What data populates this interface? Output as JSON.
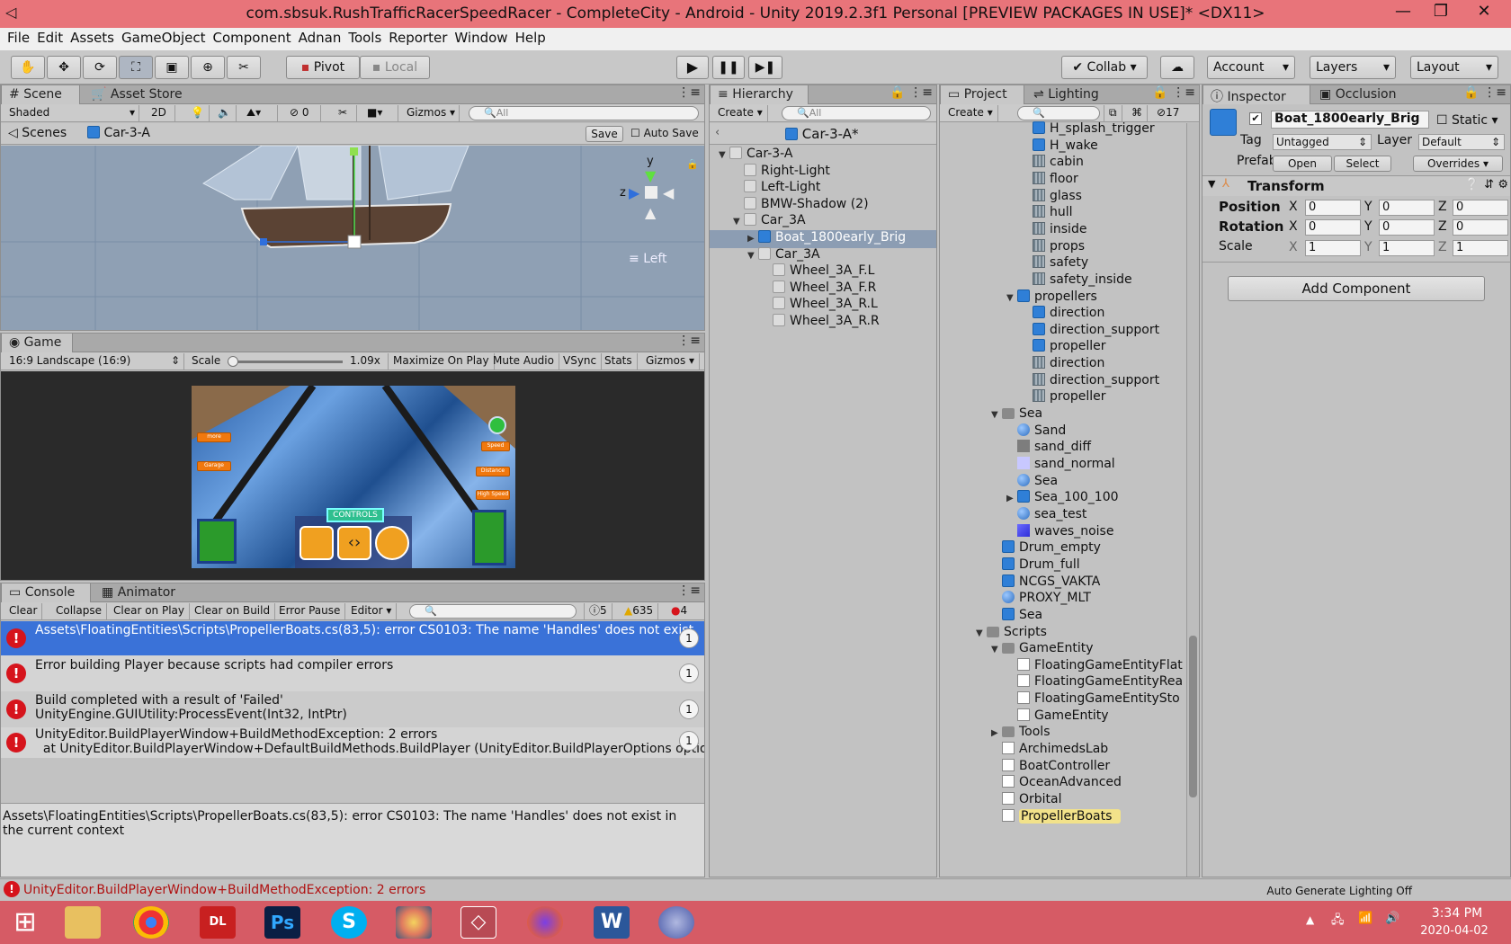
{
  "window": {
    "title": "com.sbsuk.RushTrafficRacerSpeedRacer - CompleteCity - Android - Unity 2019.2.3f1 Personal [PREVIEW PACKAGES IN USE]* <DX11>",
    "minimize": "—",
    "maximize": "❐",
    "close": "✕"
  },
  "menu": [
    "File",
    "Edit",
    "Assets",
    "GameObject",
    "Component",
    "Adnan",
    "Tools",
    "Reporter",
    "Window",
    "Help"
  ],
  "toolbar": {
    "pivot": "Pivot",
    "local": "Local",
    "collab": "Collab",
    "account": "Account",
    "layers": "Layers",
    "layout": "Layout"
  },
  "scene": {
    "tab_scene": "Scene",
    "tab_asset_store": "Asset Store",
    "shading": "Shaded",
    "mode_2d": "2D",
    "hidden_count": "0",
    "gizmos": "Gizmos",
    "search_placeholder": "All",
    "breadcrumb_root": "Scenes",
    "breadcrumb_item": "Car-3-A",
    "save": "Save",
    "auto_save": "Auto Save",
    "view_label": "Left",
    "axis_y": "y",
    "axis_z": "z"
  },
  "game": {
    "tab": "Game",
    "aspect": "16:9 Landscape (16:9)",
    "scale_label": "Scale",
    "scale_value": "1.09x",
    "maximize_on_play": "Maximize On Play",
    "mute_audio": "Mute Audio",
    "vsync": "VSync",
    "stats": "Stats",
    "gizmos": "Gizmos",
    "hud": {
      "controls": "CONTROLS",
      "more": "more",
      "garage": "Garage",
      "speed": "Speed",
      "distance": "Distance",
      "high_speed": "High Speed"
    }
  },
  "console": {
    "tab": "Console",
    "tab_animator": "Animator",
    "clear": "Clear",
    "collapse": "Collapse",
    "clear_on_play": "Clear on Play",
    "clear_on_build": "Clear on Build",
    "error_pause": "Error Pause",
    "editor": "Editor",
    "log_count": "5",
    "warn_count": "635",
    "error_count": "4",
    "messages": [
      {
        "line1": "Assets\\FloatingEntities\\Scripts\\PropellerBoats.cs(83,5): error CS0103: The name 'Handles' does not exist",
        "line2": "",
        "count": "1",
        "selected": true
      },
      {
        "line1": "Error building Player because scripts had compiler errors",
        "line2": "",
        "count": "1",
        "selected": false
      },
      {
        "line1": "Build completed with a result of 'Failed'",
        "line2": "UnityEngine.GUIUtility:ProcessEvent(Int32, IntPtr)",
        "count": "1",
        "selected": false
      },
      {
        "line1": "UnityEditor.BuildPlayerWindow+BuildMethodException: 2 errors",
        "line2": "  at UnityEditor.BuildPlayerWindow+DefaultBuildMethods.BuildPlayer (UnityEditor.BuildPlayerOptions options)",
        "count": "1",
        "selected": false
      }
    ],
    "detail_line1": "Assets\\FloatingEntities\\Scripts\\PropellerBoats.cs(83,5): error CS0103: The name 'Handles' does not exist in",
    "detail_line2": "the current context"
  },
  "hierarchy": {
    "tab": "Hierarchy",
    "create": "Create",
    "search_placeholder": "All",
    "scene_name": "Car-3-A*",
    "items": [
      {
        "label": "Car-3-A",
        "indent": 0,
        "arrow": "▼",
        "icon": "cubeg",
        "selected": false
      },
      {
        "label": "Right-Light",
        "indent": 1,
        "arrow": "",
        "icon": "cubeg",
        "selected": false
      },
      {
        "label": "Left-Light",
        "indent": 1,
        "arrow": "",
        "icon": "cubeg",
        "selected": false
      },
      {
        "label": "BMW-Shadow (2)",
        "indent": 1,
        "arrow": "",
        "icon": "cubeg",
        "selected": false
      },
      {
        "label": "Car_3A",
        "indent": 1,
        "arrow": "▼",
        "icon": "cubeg",
        "selected": false
      },
      {
        "label": "Boat_1800early_Brig",
        "indent": 2,
        "arrow": "▶",
        "icon": "cube",
        "selected": true
      },
      {
        "label": "Car_3A",
        "indent": 2,
        "arrow": "▼",
        "icon": "cubeg",
        "selected": false
      },
      {
        "label": "Wheel_3A_F.L",
        "indent": 3,
        "arrow": "",
        "icon": "cubeg",
        "selected": false
      },
      {
        "label": "Wheel_3A_F.R",
        "indent": 3,
        "arrow": "",
        "icon": "cubeg",
        "selected": false
      },
      {
        "label": "Wheel_3A_R.L",
        "indent": 3,
        "arrow": "",
        "icon": "cubeg",
        "selected": false
      },
      {
        "label": "Wheel_3A_R.R",
        "indent": 3,
        "arrow": "",
        "icon": "cubeg",
        "selected": false
      }
    ]
  },
  "project": {
    "tab": "Project",
    "tab_lighting": "Lighting",
    "create": "Create",
    "hidden_count": "17",
    "items": [
      {
        "label": "H_splash_trigger",
        "indent": 3,
        "arrow": "",
        "icon": "cube"
      },
      {
        "label": "H_wake",
        "indent": 3,
        "arrow": "",
        "icon": "cube"
      },
      {
        "label": "cabin",
        "indent": 3,
        "arrow": "",
        "icon": "mesh"
      },
      {
        "label": "floor",
        "indent": 3,
        "arrow": "",
        "icon": "mesh"
      },
      {
        "label": "glass",
        "indent": 3,
        "arrow": "",
        "icon": "mesh"
      },
      {
        "label": "hull",
        "indent": 3,
        "arrow": "",
        "icon": "mesh"
      },
      {
        "label": "inside",
        "indent": 3,
        "arrow": "",
        "icon": "mesh"
      },
      {
        "label": "props",
        "indent": 3,
        "arrow": "",
        "icon": "mesh"
      },
      {
        "label": "safety",
        "indent": 3,
        "arrow": "",
        "icon": "mesh"
      },
      {
        "label": "safety_inside",
        "indent": 3,
        "arrow": "",
        "icon": "mesh"
      },
      {
        "label": "propellers",
        "indent": 2,
        "arrow": "▼",
        "icon": "cube"
      },
      {
        "label": "direction",
        "indent": 3,
        "arrow": "",
        "icon": "cube"
      },
      {
        "label": "direction_support",
        "indent": 3,
        "arrow": "",
        "icon": "cube"
      },
      {
        "label": "propeller",
        "indent": 3,
        "arrow": "",
        "icon": "cube"
      },
      {
        "label": "direction",
        "indent": 3,
        "arrow": "",
        "icon": "mesh"
      },
      {
        "label": "direction_support",
        "indent": 3,
        "arrow": "",
        "icon": "mesh"
      },
      {
        "label": "propeller",
        "indent": 3,
        "arrow": "",
        "icon": "mesh"
      },
      {
        "label": "Sea",
        "indent": 1,
        "arrow": "▼",
        "icon": "folder"
      },
      {
        "label": "Sand",
        "indent": 2,
        "arrow": "",
        "icon": "sphere"
      },
      {
        "label": "sand_diff",
        "indent": 2,
        "arrow": "",
        "icon": "tex_gray"
      },
      {
        "label": "sand_normal",
        "indent": 2,
        "arrow": "",
        "icon": "tex_lav"
      },
      {
        "label": "Sea",
        "indent": 2,
        "arrow": "",
        "icon": "sphere"
      },
      {
        "label": "Sea_100_100",
        "indent": 2,
        "arrow": "▶",
        "icon": "cube"
      },
      {
        "label": "sea_test",
        "indent": 2,
        "arrow": "",
        "icon": "sphere"
      },
      {
        "label": "waves_noise",
        "indent": 2,
        "arrow": "",
        "icon": "tex_blue"
      },
      {
        "label": "Drum_empty",
        "indent": 1,
        "arrow": "",
        "icon": "cube"
      },
      {
        "label": "Drum_full",
        "indent": 1,
        "arrow": "",
        "icon": "cube"
      },
      {
        "label": "NCGS_VAKTA",
        "indent": 1,
        "arrow": "",
        "icon": "cube"
      },
      {
        "label": "PROXY_MLT",
        "indent": 1,
        "arrow": "",
        "icon": "sphere"
      },
      {
        "label": "Sea",
        "indent": 1,
        "arrow": "",
        "icon": "cube"
      },
      {
        "label": "Scripts",
        "indent": 0,
        "arrow": "▼",
        "icon": "folder"
      },
      {
        "label": "GameEntity",
        "indent": 1,
        "arrow": "▼",
        "icon": "folder"
      },
      {
        "label": "FloatingGameEntityFlat",
        "indent": 2,
        "arrow": "",
        "icon": "script"
      },
      {
        "label": "FloatingGameEntityRea",
        "indent": 2,
        "arrow": "",
        "icon": "script"
      },
      {
        "label": "FloatingGameEntitySto",
        "indent": 2,
        "arrow": "",
        "icon": "script"
      },
      {
        "label": "GameEntity",
        "indent": 2,
        "arrow": "",
        "icon": "script"
      },
      {
        "label": "Tools",
        "indent": 1,
        "arrow": "▶",
        "icon": "folder"
      },
      {
        "label": "ArchimedsLab",
        "indent": 1,
        "arrow": "",
        "icon": "script"
      },
      {
        "label": "BoatController",
        "indent": 1,
        "arrow": "",
        "icon": "script"
      },
      {
        "label": "OceanAdvanced",
        "indent": 1,
        "arrow": "",
        "icon": "script"
      },
      {
        "label": "Orbital",
        "indent": 1,
        "arrow": "",
        "icon": "script"
      },
      {
        "label": "PropellerBoats",
        "indent": 1,
        "arrow": "",
        "icon": "script",
        "highlight": true
      }
    ]
  },
  "inspector": {
    "tab": "Inspector",
    "tab_occlusion": "Occlusion",
    "object_name": "Boat_1800early_Brig",
    "static": "Static",
    "tag_label": "Tag",
    "tag_value": "Untagged",
    "layer_label": "Layer",
    "layer_value": "Default",
    "prefab_label": "Prefab",
    "open": "Open",
    "select": "Select",
    "overrides": "Overrides",
    "transform": "Transform",
    "position_label": "Position",
    "rotation_label": "Rotation",
    "scale_label": "Scale",
    "position": {
      "x": "0",
      "y": "0",
      "z": "0"
    },
    "rotation": {
      "x": "0",
      "y": "0",
      "z": "0"
    },
    "scale": {
      "x": "1",
      "y": "1",
      "z": "1"
    },
    "axis_x": "X",
    "axis_y": "Y",
    "axis_z": "Z",
    "add_component": "Add Component"
  },
  "status": {
    "message": "UnityEditor.BuildPlayerWindow+BuildMethodException: 2 errors",
    "lighting": "Auto Generate Lighting Off"
  },
  "taskbar": {
    "time": "3:34 PM",
    "date": "2020-04-02"
  }
}
